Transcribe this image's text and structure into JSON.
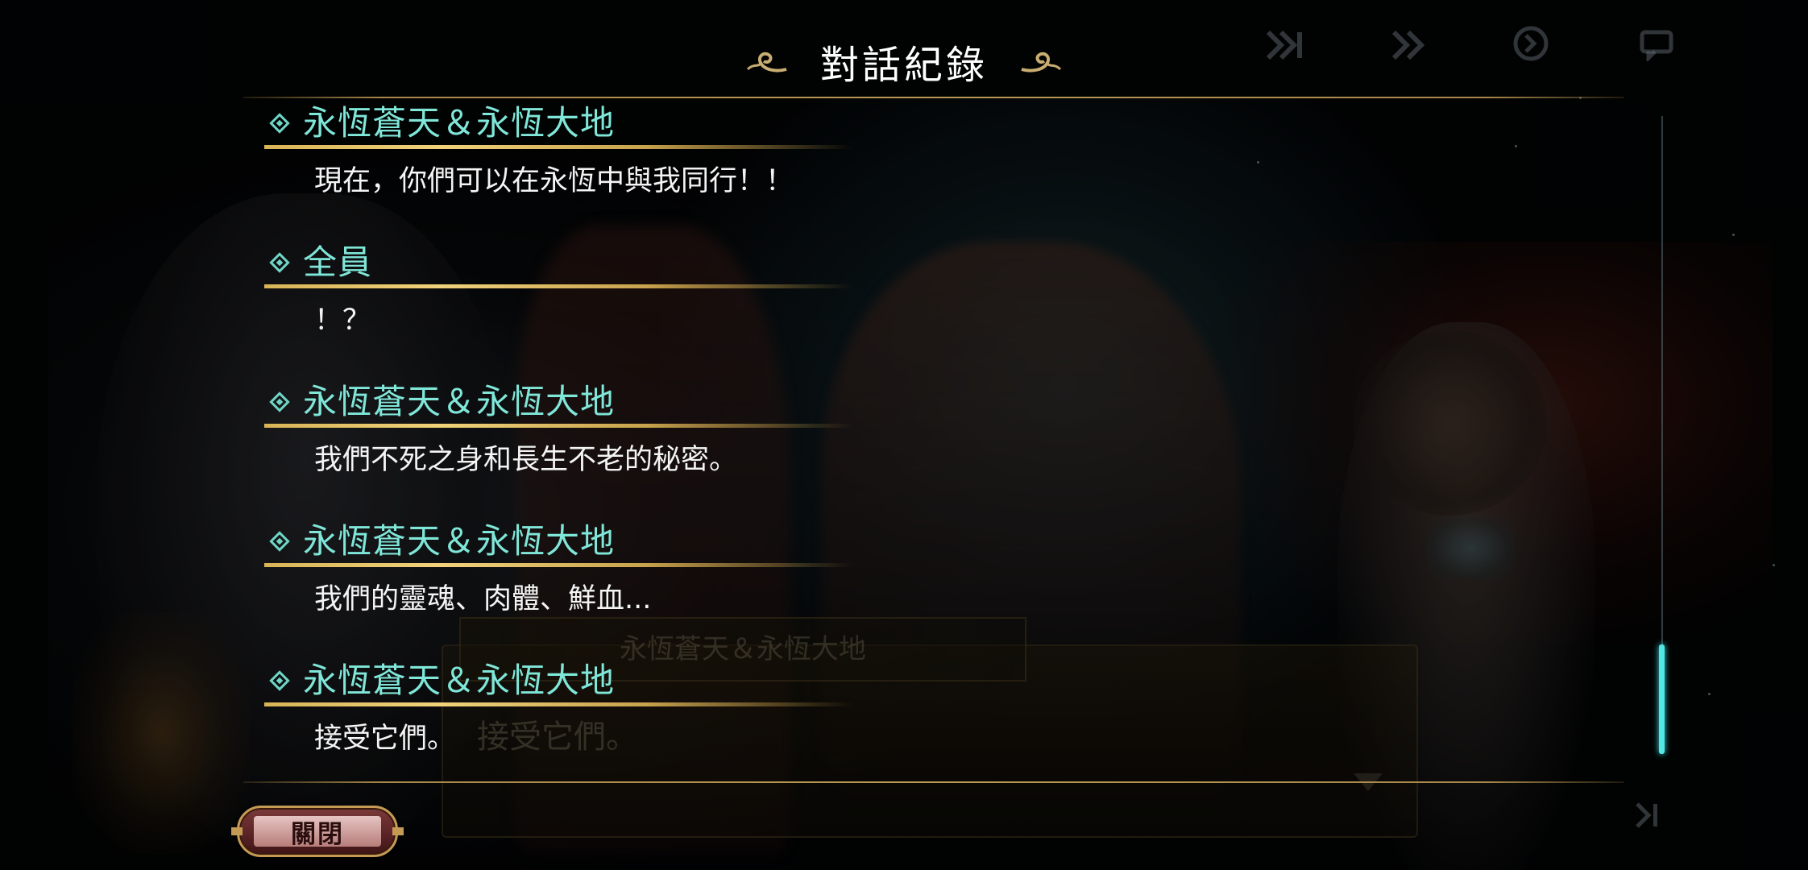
{
  "header": {
    "title": "對話紀錄"
  },
  "log": [
    {
      "speaker": "永恆蒼天＆永恆大地",
      "text": "現在，你們可以在永恆中與我同行！！"
    },
    {
      "speaker": "全員",
      "text": "！？"
    },
    {
      "speaker": "永恆蒼天＆永恆大地",
      "text": "我們不死之身和長生不老的秘密。"
    },
    {
      "speaker": "永恆蒼天＆永恆大地",
      "text": "我們的靈魂、肉體、鮮血..."
    },
    {
      "speaker": "永恆蒼天＆永恆大地",
      "text": "接受它們。"
    }
  ],
  "background_textbox": {
    "speaker": "永恆蒼天＆永恆大地",
    "text": "接受它們。"
  },
  "close_button": {
    "label": "關閉"
  },
  "icons": {
    "title_left": "ornament-flourish-icon",
    "title_right": "ornament-flourish-icon",
    "entry_marker": "diamond-icon",
    "top_controls": [
      "skip-icon",
      "fast-forward-icon",
      "auto-icon",
      "log-icon"
    ]
  },
  "colors": {
    "speaker": "#7fe6d8",
    "underline": "#e0bd62",
    "scroll_thumb": "#53e6e6",
    "rule": "#b89954"
  },
  "scroll": {
    "position_fraction": 1.0
  }
}
